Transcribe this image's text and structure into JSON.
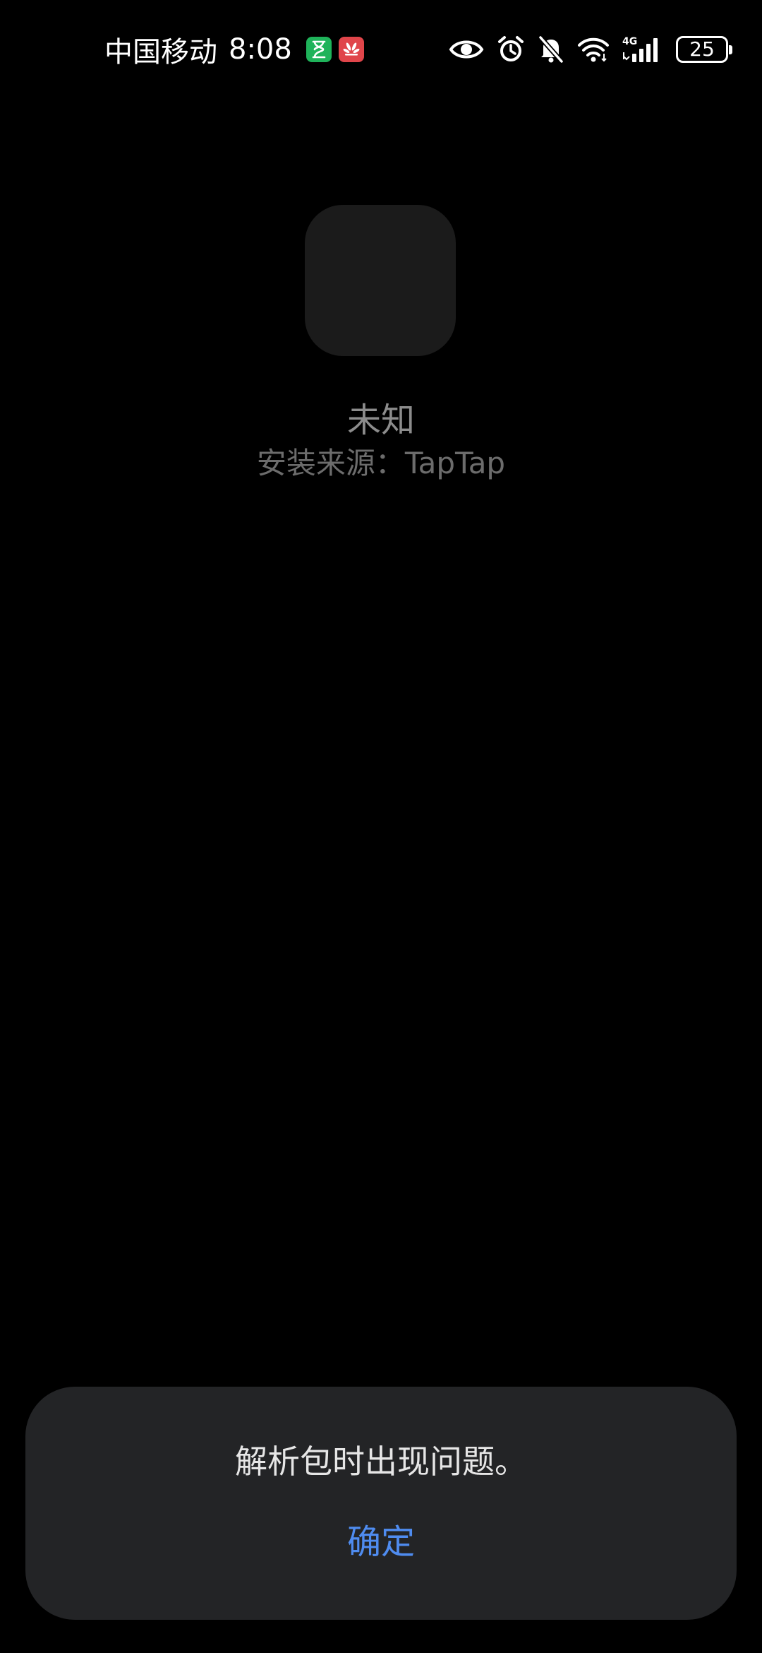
{
  "status_bar": {
    "carrier": "中国移动",
    "time": "8:08",
    "notification_icons": [
      "hourglass-icon",
      "huawei-icon"
    ],
    "system_icons": [
      "eye-icon",
      "alarm-icon",
      "mute-icon",
      "wifi-icon",
      "signal-4g-icon"
    ],
    "network_label": "4G",
    "battery_level": "25"
  },
  "app": {
    "name": "未知",
    "install_source": "安装来源：TapTap"
  },
  "dialog": {
    "message": "解析包时出现问题。",
    "confirm_label": "确定"
  },
  "colors": {
    "background": "#000000",
    "dialog_background": "#232426",
    "accent": "#4f8cf0",
    "app_icon_placeholder": "#1b1b1b"
  }
}
